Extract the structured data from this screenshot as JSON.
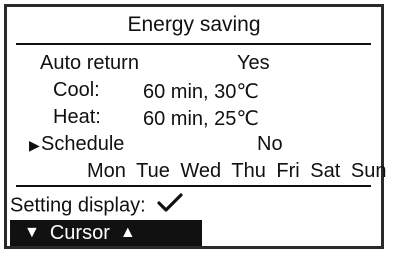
{
  "screen": {
    "title": "Energy saving",
    "auto_return": {
      "label": "Auto return",
      "value": "Yes"
    },
    "cool": {
      "label": "Cool:",
      "value": "60 min, 30℃"
    },
    "heat": {
      "label": "Heat:",
      "value": "60 min, 25℃"
    },
    "schedule": {
      "label": "Schedule",
      "value": "No",
      "selected": true
    },
    "days": [
      "Mon",
      "Tue",
      "Wed",
      "Thu",
      "Fri",
      "Sat",
      "Sun"
    ],
    "setting_display_label": "Setting display:",
    "setting_display_icon": "checkmark-icon",
    "cursor_bar": {
      "label": "Cursor",
      "down_icon": "triangle-down-icon",
      "up_icon": "triangle-up-icon"
    }
  }
}
